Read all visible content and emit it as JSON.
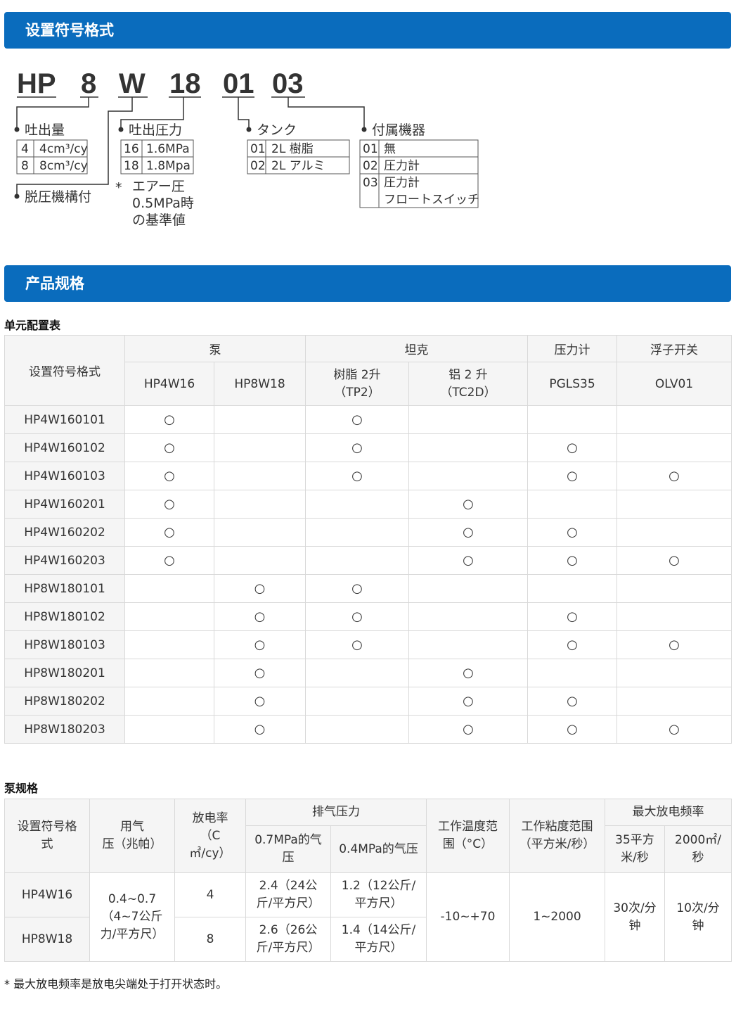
{
  "section1": {
    "title": "设置符号格式"
  },
  "diagram": {
    "codes": [
      "HP",
      "8",
      "W",
      "18",
      "01",
      "03"
    ],
    "discharge": {
      "label": "吐出量",
      "rows": [
        {
          "code": "4",
          "value": "4cm³/cy"
        },
        {
          "code": "8",
          "value": "8cm³/cy"
        }
      ]
    },
    "relief_label": "脱圧機構付",
    "pressure": {
      "label": "吐出圧力",
      "rows": [
        {
          "code": "16",
          "value": "1.6MPa"
        },
        {
          "code": "18",
          "value": "1.8Mpa"
        }
      ],
      "note_mark": "*",
      "note_lines": [
        "エアー圧",
        "0.5MPa時",
        "の基準値"
      ]
    },
    "tank": {
      "label": "タンク",
      "rows": [
        {
          "code": "01",
          "value": "2L 樹脂"
        },
        {
          "code": "02",
          "value": "2L アルミ"
        }
      ]
    },
    "accessory": {
      "label": "付属機器",
      "rows": [
        {
          "code": "01",
          "value": "無"
        },
        {
          "code": "02",
          "value": "圧力計"
        },
        {
          "code": "03",
          "value": "圧力計",
          "value2": "フロートスイッチ"
        }
      ]
    }
  },
  "section2": {
    "title": "产品规格"
  },
  "config_table": {
    "subtitle": "单元配置表",
    "header_code": "设置符号格式",
    "groups": [
      "泵",
      "坦克",
      "压力计",
      "浮子开关"
    ],
    "columns": [
      "HP4W16",
      "HP8W18",
      "树脂 2升",
      "（TP2）",
      "铝 2 升",
      "（TC2D）",
      "PGLS35",
      "OLV01"
    ],
    "mark": "○",
    "rows": [
      {
        "code": "HP4W160101",
        "marks": [
          1,
          0,
          1,
          0,
          0,
          0
        ]
      },
      {
        "code": "HP4W160102",
        "marks": [
          1,
          0,
          1,
          0,
          1,
          0
        ]
      },
      {
        "code": "HP4W160103",
        "marks": [
          1,
          0,
          1,
          0,
          1,
          1
        ]
      },
      {
        "code": "HP4W160201",
        "marks": [
          1,
          0,
          0,
          1,
          0,
          0
        ]
      },
      {
        "code": "HP4W160202",
        "marks": [
          1,
          0,
          0,
          1,
          1,
          0
        ]
      },
      {
        "code": "HP4W160203",
        "marks": [
          1,
          0,
          0,
          1,
          1,
          1
        ]
      },
      {
        "code": "HP8W180101",
        "marks": [
          0,
          1,
          1,
          0,
          0,
          0
        ]
      },
      {
        "code": "HP8W180102",
        "marks": [
          0,
          1,
          1,
          0,
          1,
          0
        ]
      },
      {
        "code": "HP8W180103",
        "marks": [
          0,
          1,
          1,
          0,
          1,
          1
        ]
      },
      {
        "code": "HP8W180201",
        "marks": [
          0,
          1,
          0,
          1,
          0,
          0
        ]
      },
      {
        "code": "HP8W180202",
        "marks": [
          0,
          1,
          0,
          1,
          1,
          0
        ]
      },
      {
        "code": "HP8W180203",
        "marks": [
          0,
          1,
          0,
          1,
          1,
          1
        ]
      }
    ]
  },
  "spec_table": {
    "subtitle": "泵规格",
    "h_code": [
      "设置符号格",
      "式"
    ],
    "h_air": [
      "用气",
      "压（兆帕）"
    ],
    "h_rate": [
      "放电率",
      "（C",
      "㎥/cy）"
    ],
    "h_exhaust": "排气压力",
    "h_07": [
      "0.7MPa的气",
      "压"
    ],
    "h_04": "0.4MPa的气压",
    "h_temp": [
      "工作温度范",
      "围（°C）"
    ],
    "h_visc": [
      "工作粘度范围",
      "（平方米/秒）"
    ],
    "h_freq": "最大放电频率",
    "h_35": [
      "35平方",
      "米/秒"
    ],
    "h_2000": [
      "2000㎡/",
      "秒"
    ],
    "air_value": [
      "0.4~0.7",
      "（4~7公斤",
      "力/平方尺）"
    ],
    "temp_value": "-10~+70",
    "visc_value": "1~2000",
    "freq35_value": [
      "30次/分",
      "钟"
    ],
    "freq2000_value": [
      "10次/分",
      "钟"
    ],
    "rows": [
      {
        "code": "HP4W16",
        "rate": "4",
        "p07": [
          "2.4（24公",
          "斤/平方尺）"
        ],
        "p04": [
          "1.2（12公斤/",
          "平方尺）"
        ]
      },
      {
        "code": "HP8W18",
        "rate": "8",
        "p07": [
          "2.6（26公",
          "斤/平方尺）"
        ],
        "p04": [
          "1.4（14公斤/",
          "平方尺）"
        ]
      }
    ]
  },
  "footnote": "*  最大放电频率是放电尖端处于打开状态时。"
}
